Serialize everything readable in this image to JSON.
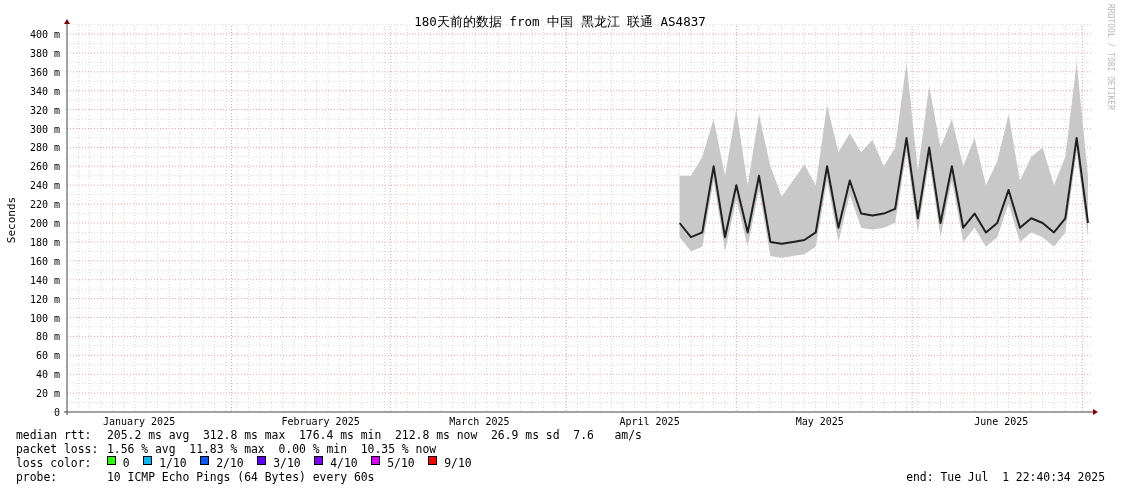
{
  "graph": {
    "title": "180天前的数据 from 中国 黑龙江 联通 AS4837",
    "credit": "RRDTOOL / TOBI OETIKER",
    "chart_data": {
      "type": "line",
      "grid": true,
      "ylabel": "Seconds",
      "ylim": [
        0,
        410
      ],
      "categories": [
        null,
        null,
        null,
        null,
        null,
        null,
        "January 2025",
        null,
        null,
        null,
        null,
        null,
        null,
        null,
        null,
        null,
        null,
        null,
        null,
        null,
        null,
        null,
        "February 2025",
        null,
        null,
        null,
        null,
        null,
        null,
        null,
        null,
        null,
        null,
        null,
        null,
        null,
        "March 2025",
        null,
        null,
        null,
        null,
        null,
        null,
        null,
        null,
        null,
        null,
        null,
        null,
        null,
        null,
        "April 2025",
        null,
        null,
        null,
        null,
        null,
        null,
        null,
        null,
        null,
        null,
        null,
        null,
        null,
        null,
        "May 2025",
        null,
        null,
        null,
        null,
        null,
        null,
        null,
        null,
        null,
        null,
        null,
        null,
        null,
        null,
        null,
        "June 2025",
        null,
        null,
        null,
        null,
        null,
        null,
        null,
        null
      ],
      "yticks": [
        {
          "value": 0,
          "label": "0"
        },
        {
          "value": 20,
          "label": "20 m"
        },
        {
          "value": 40,
          "label": "40 m"
        },
        {
          "value": 60,
          "label": "60 m"
        },
        {
          "value": 80,
          "label": "80 m"
        },
        {
          "value": 100,
          "label": "100 m"
        },
        {
          "value": 120,
          "label": "120 m"
        },
        {
          "value": 140,
          "label": "140 m"
        },
        {
          "value": 160,
          "label": "160 m"
        },
        {
          "value": 180,
          "label": "180 m"
        },
        {
          "value": 200,
          "label": "200 m"
        },
        {
          "value": 220,
          "label": "220 m"
        },
        {
          "value": 240,
          "label": "240 m"
        },
        {
          "value": 260,
          "label": "260 m"
        },
        {
          "value": 280,
          "label": "280 m"
        },
        {
          "value": 300,
          "label": "300 m"
        },
        {
          "value": 320,
          "label": "320 m"
        },
        {
          "value": 340,
          "label": "340 m"
        },
        {
          "value": 360,
          "label": "360 m"
        },
        {
          "value": 380,
          "label": "380 m"
        },
        {
          "value": 400,
          "label": "400 m"
        }
      ],
      "series": [
        {
          "color": "#202020",
          "values": [
            null,
            null,
            null,
            null,
            null,
            null,
            null,
            null,
            null,
            null,
            null,
            null,
            null,
            null,
            null,
            null,
            null,
            null,
            null,
            null,
            null,
            null,
            null,
            null,
            null,
            null,
            null,
            null,
            null,
            null,
            null,
            null,
            null,
            null,
            null,
            null,
            null,
            null,
            null,
            null,
            null,
            null,
            null,
            null,
            null,
            null,
            null,
            null,
            null,
            null,
            null,
            null,
            null,
            null,
            200,
            185,
            190,
            260,
            185,
            240,
            190,
            250,
            180,
            178,
            180,
            182,
            190,
            260,
            195,
            245,
            210,
            208,
            210,
            215,
            290,
            205,
            280,
            200,
            260,
            195,
            210,
            190,
            200,
            235,
            195,
            205,
            200,
            190,
            205,
            290,
            200
          ]
        }
      ]
    }
  },
  "legend": [
    {
      "label": "median rtt:",
      "items": [
        "205.2 ms avg",
        "312.8 ms max",
        "176.4 ms min",
        "212.8 ms now",
        "26.9 ms sd",
        "7.6   am/s"
      ]
    },
    {
      "label": "packet loss:",
      "items": [
        "1.56 % avg",
        "11.83 % max",
        "0.00 % min",
        "10.35 % now"
      ]
    },
    {
      "label": "loss color:",
      "swatches": [
        {
          "label": "0",
          "color": "#26ff00"
        },
        {
          "label": "1/10",
          "color": "#00b8ff"
        },
        {
          "label": "2/10",
          "color": "#0059ff"
        },
        {
          "label": "3/10",
          "color": "#5e00ff"
        },
        {
          "label": "4/10",
          "color": "#7e00ff"
        },
        {
          "label": "5/10",
          "color": "#dd00ff"
        },
        {
          "label": "9/10",
          "color": "#ff0000"
        }
      ]
    },
    {
      "label": "probe:",
      "items": [
        "10 ICMP Echo Pings (64 Bytes) every 60s"
      ],
      "end": "end: Tue Jul  1 22:40:34 2025"
    }
  ]
}
